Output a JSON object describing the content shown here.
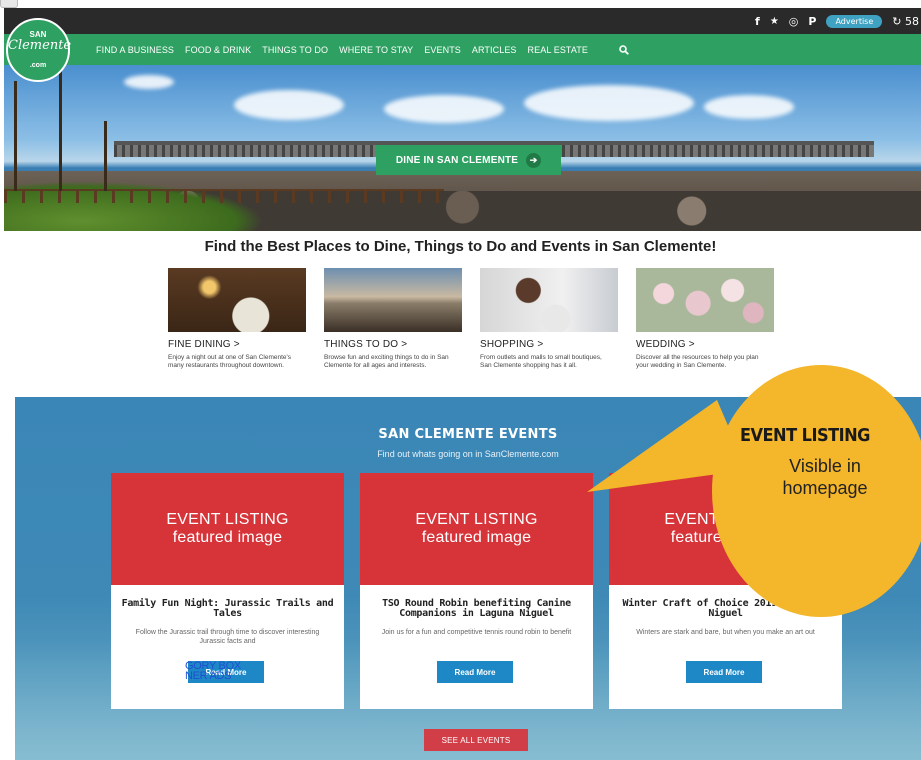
{
  "topbar": {
    "social_icons": [
      "facebook-icon",
      "twitter-icon",
      "instagram-icon",
      "pinterest-icon"
    ],
    "social_glyphs": [
      "f",
      "★",
      "◎",
      "P"
    ],
    "advertise_label": "Advertise",
    "weather": "58"
  },
  "logo": {
    "line1": "SAN",
    "line2": "Clemente",
    "line3": ".com"
  },
  "nav": {
    "items": [
      "FIND A BUSINESS",
      "FOOD & DRINK",
      "THINGS TO DO",
      "WHERE TO STAY",
      "EVENTS",
      "ARTICLES",
      "REAL ESTATE"
    ]
  },
  "hero": {
    "cta_label": "DINE IN SAN CLEMENTE",
    "cta_arrow": "➔"
  },
  "headline": "Find the Best Places to Dine, Things to Do and Events in San Clemente!",
  "categories": [
    {
      "title": "FINE DINING >",
      "desc": "Enjoy a night out at one of San Clemente's many restaurants throughout downtown."
    },
    {
      "title": "THINGS TO DO >",
      "desc": "Browse fun and exciting things to do in San Clemente for all ages and interests."
    },
    {
      "title": "SHOPPING >",
      "desc": "From outlets and malls to small boutiques, San Clemente shopping has it all."
    },
    {
      "title": "WEDDING >",
      "desc": "Discover all the resources to help you plan your wedding in San Clemente."
    }
  ],
  "events": {
    "title": "SAN CLEMENTE EVENTS",
    "subtitle": "Find out whats going on in SanClemente.com",
    "cards": [
      {
        "img_line1": "EVENT LISTING",
        "img_line2": "featured image",
        "title": "Family Fun Night: Jurassic Trails and Tales",
        "desc": "Follow the Jurassic trail through time to discover interesting Jurassic facts and",
        "button": "Read More",
        "overlap": "GORY BOX\nNER ADS"
      },
      {
        "img_line1": "EVENT LISTING",
        "img_line2": "featured image",
        "title": "TSO Round Robin benefiting Canine Companions in Laguna Niguel",
        "desc": "Join us for a fun and competitive tennis round robin to benefit",
        "button": "Read More"
      },
      {
        "img_line1": "EVENT LISTING",
        "img_line2": "featured image",
        "title": "Winter Craft of Choice 2019 - Laguna Niguel",
        "desc": "Winters are stark and bare, but when you make an art out",
        "button": "Read More"
      }
    ],
    "see_all_label": "SEE ALL EVENTS"
  },
  "callout": {
    "title": "EVENT LISTING",
    "line1": "Visible in",
    "line2": "homepage"
  },
  "colors": {
    "nav_green": "#2ea162",
    "event_red": "#d7343a",
    "button_blue": "#1e88c7",
    "callout_yellow": "#f4b62a",
    "section_blue": "#3a86b6"
  }
}
